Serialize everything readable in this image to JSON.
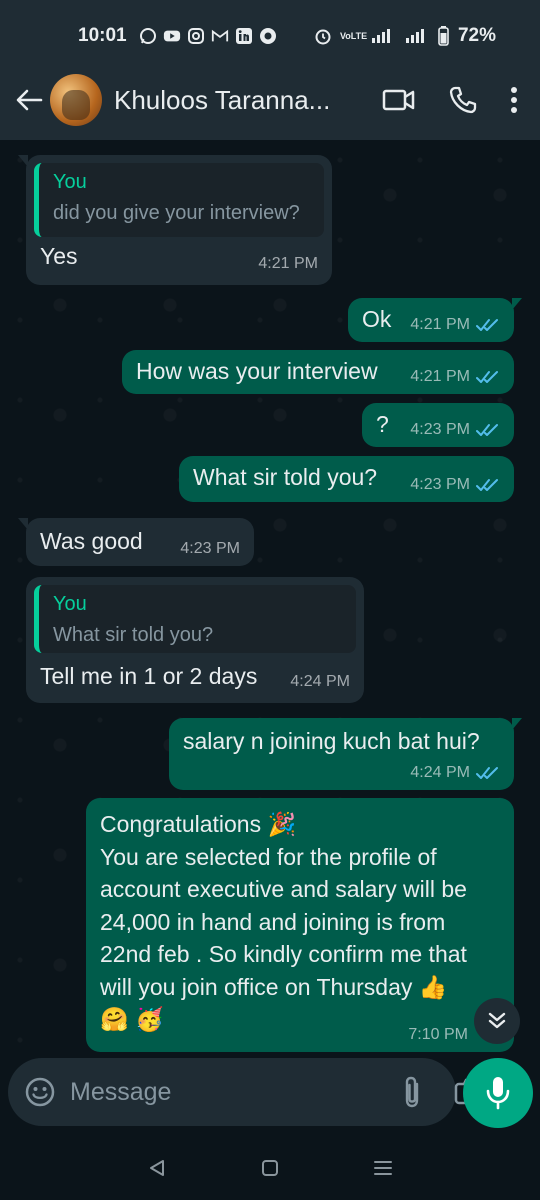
{
  "status_bar": {
    "time": "10:01",
    "notification_icons": [
      "whatsapp-icon",
      "youtube-icon",
      "instagram-icon",
      "gmail-icon",
      "linkedin-icon",
      "record-icon"
    ],
    "network_label": "VoLTE",
    "battery_percent": "72%"
  },
  "header": {
    "contact_name": "Khuloos Taranna...",
    "actions": [
      "video-call-icon",
      "voice-call-icon",
      "more-options-icon"
    ]
  },
  "messages": [
    {
      "direction": "incoming",
      "quote_author": "You",
      "quote_text": "did you give your interview?",
      "text": "Yes",
      "time": "4:21 PM"
    },
    {
      "direction": "outgoing",
      "text": "Ok",
      "time": "4:21 PM",
      "status": "read"
    },
    {
      "direction": "outgoing",
      "text": "How was your interview",
      "time": "4:21 PM",
      "status": "read"
    },
    {
      "direction": "outgoing",
      "text": "?",
      "time": "4:23 PM",
      "status": "read"
    },
    {
      "direction": "outgoing",
      "text": "What sir told you?",
      "time": "4:23 PM",
      "status": "read"
    },
    {
      "direction": "incoming",
      "text": "Was good",
      "time": "4:23 PM"
    },
    {
      "direction": "incoming",
      "quote_author": "You",
      "quote_text": "What sir told you?",
      "text": "Tell me in 1 or 2 days",
      "time": "4:24 PM"
    },
    {
      "direction": "outgoing",
      "text": "salary n joining kuch bat hui?",
      "time": "4:24 PM",
      "status": "read"
    },
    {
      "direction": "outgoing",
      "lines": [
        "Congratulations 🎉",
        "You are selected for the profile of",
        "account executive and salary will be",
        "24,000 in hand and joining is from",
        "22nd feb . So kindly confirm me that",
        "will you join office on Thursday 👍",
        "🤗 🥳"
      ],
      "time": "7:10 PM",
      "status": "read"
    }
  ],
  "input": {
    "placeholder": "Message"
  },
  "colors": {
    "accent": "#00a884",
    "outgoing_bubble": "#005c4b",
    "incoming_bubble": "#1f2c34",
    "read_tick": "#53bdeb",
    "quote_author": "#06cf9c"
  }
}
